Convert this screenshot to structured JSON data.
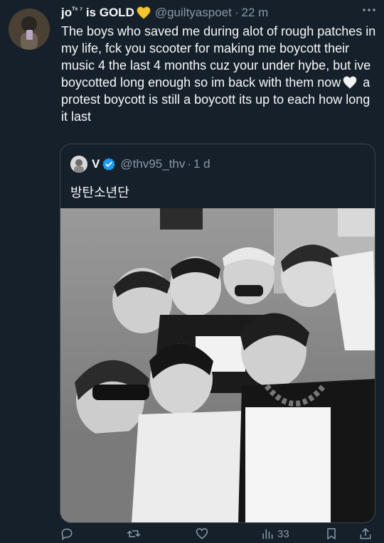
{
  "tweet": {
    "display_name": "jo",
    "name_superscript": "ᵀˢ ⁷",
    "name_suffix": " is GOLD",
    "handle": "@guiltyaspoet",
    "separator": "·",
    "time": "22 m",
    "text_part1": "The boys who saved me during alot of rough patches in my life, fck you scooter for making me boycott their music 4 the last 4 months cuz your under hybe, but ive boycotted long enough so im back with them now",
    "text_part2": " a protest boycott is still a boycott its up to each how long it last"
  },
  "quoted_tweet": {
    "display_name": "V",
    "handle": "@thv95_thv",
    "separator": "·",
    "time": "1 d",
    "text": "방탄소년단"
  },
  "actions": {
    "reply_icon": "reply-icon",
    "retweet_icon": "retweet-icon",
    "like_icon": "heart-icon",
    "views_icon": "views-icon",
    "views_count": "33",
    "bookmark_icon": "bookmark-icon",
    "share_icon": "share-icon"
  },
  "colors": {
    "background": "#15202b",
    "text": "#f7f9f9",
    "secondary": "#8b98a5",
    "border": "#38444d",
    "verified": "#1d9bf0",
    "gold_heart": "#f7c531"
  }
}
